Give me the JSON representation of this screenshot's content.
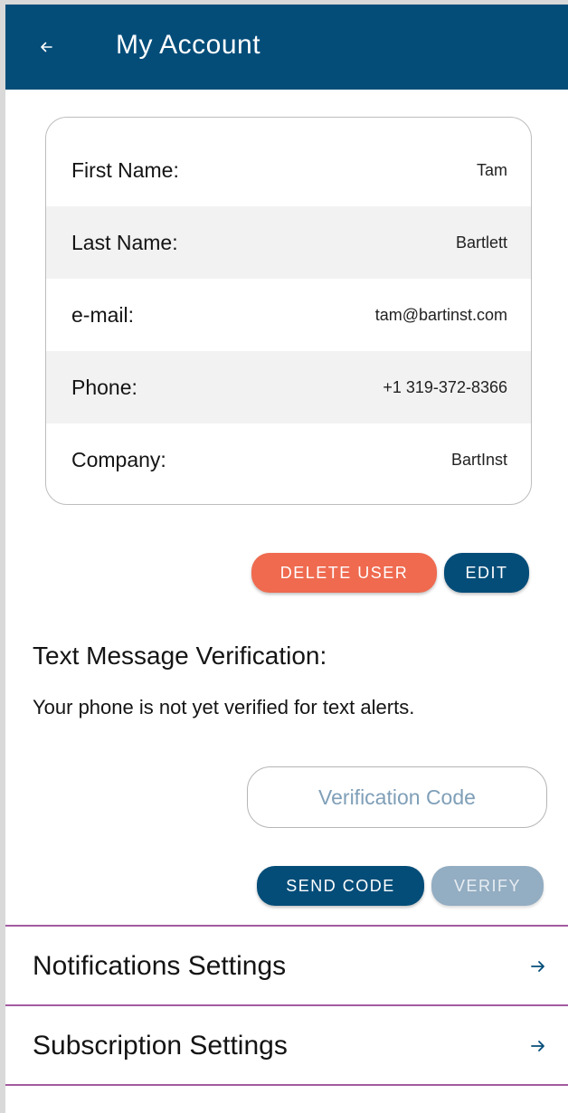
{
  "header": {
    "title": "My Account",
    "back_icon": "arrow-left-icon",
    "background": "#044d79"
  },
  "profile": {
    "rows": [
      {
        "label": "First Name:",
        "value": "Tam"
      },
      {
        "label": "Last Name:",
        "value": "Bartlett"
      },
      {
        "label": "e-mail:",
        "value": "tam@bartinst.com"
      },
      {
        "label": "Phone:",
        "value": "+1 319-372-8366"
      },
      {
        "label": "Company:",
        "value": "BartInst"
      }
    ]
  },
  "actions": {
    "delete_label": "DELETE USER",
    "edit_label": "EDIT",
    "delete_color": "#ef6a4f",
    "edit_color": "#044d79"
  },
  "verification": {
    "title": "Text Message Verification:",
    "description": "Your phone is not yet verified for text alerts.",
    "code_placeholder": "Verification Code",
    "send_label": "SEND CODE",
    "verify_label": "VERIFY"
  },
  "settings": {
    "items": [
      {
        "label": "Notifications Settings",
        "icon": "arrow-right-icon"
      },
      {
        "label": "Subscription Settings",
        "icon": "arrow-right-icon"
      }
    ],
    "divider_color": "#a35aa0"
  }
}
